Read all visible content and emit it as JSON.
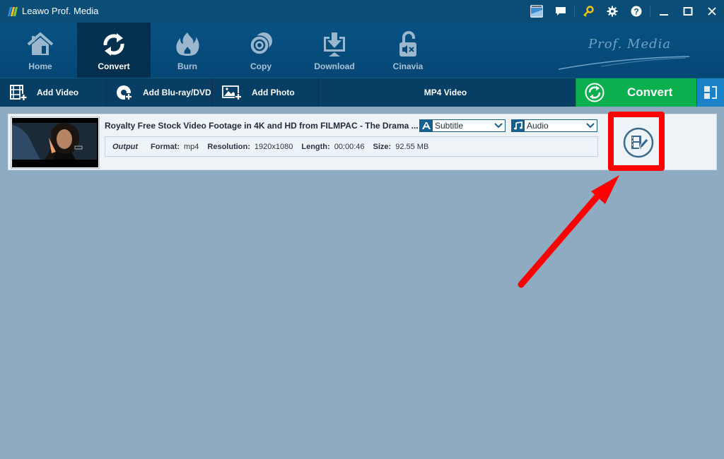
{
  "window": {
    "title": "Leawo Prof. Media",
    "icons": [
      "register-badge-icon",
      "feedback-icon",
      "key-icon",
      "settings-icon",
      "help-icon",
      "minimize-icon",
      "maximize-icon",
      "close-icon"
    ]
  },
  "nav": {
    "items": [
      {
        "label": "Home",
        "icon": "home-icon",
        "active": false
      },
      {
        "label": "Convert",
        "icon": "convert-icon",
        "active": true
      },
      {
        "label": "Burn",
        "icon": "burn-icon",
        "active": false
      },
      {
        "label": "Copy",
        "icon": "copy-icon",
        "active": false
      },
      {
        "label": "Download",
        "icon": "download-icon",
        "active": false
      },
      {
        "label": "Cinavia",
        "icon": "cinavia-icon",
        "active": false
      }
    ],
    "brand": "Prof. Media"
  },
  "toolbar": {
    "add_video": "Add Video",
    "add_bluray": "Add Blu-ray/DVD",
    "add_photo": "Add Photo",
    "format": "MP4 Video",
    "convert": "Convert"
  },
  "file": {
    "title": "Royalty Free Stock Video Footage in 4K and HD from FILMPAC - The Drama ...",
    "subtitle_select": "Subtitle",
    "audio_select": "Audio",
    "output": {
      "label": "Output",
      "format_key": "Format:",
      "format_val": "mp4",
      "resolution_key": "Resolution:",
      "resolution_val": "1920x1080",
      "length_key": "Length:",
      "length_val": "00:00:46",
      "size_key": "Size:",
      "size_val": "92.55 MB"
    }
  },
  "colors": {
    "titlebar": "#0a4e78",
    "convert_green": "#0ab04e",
    "background": "#8eabc1",
    "highlight_red": "#ff0000"
  }
}
